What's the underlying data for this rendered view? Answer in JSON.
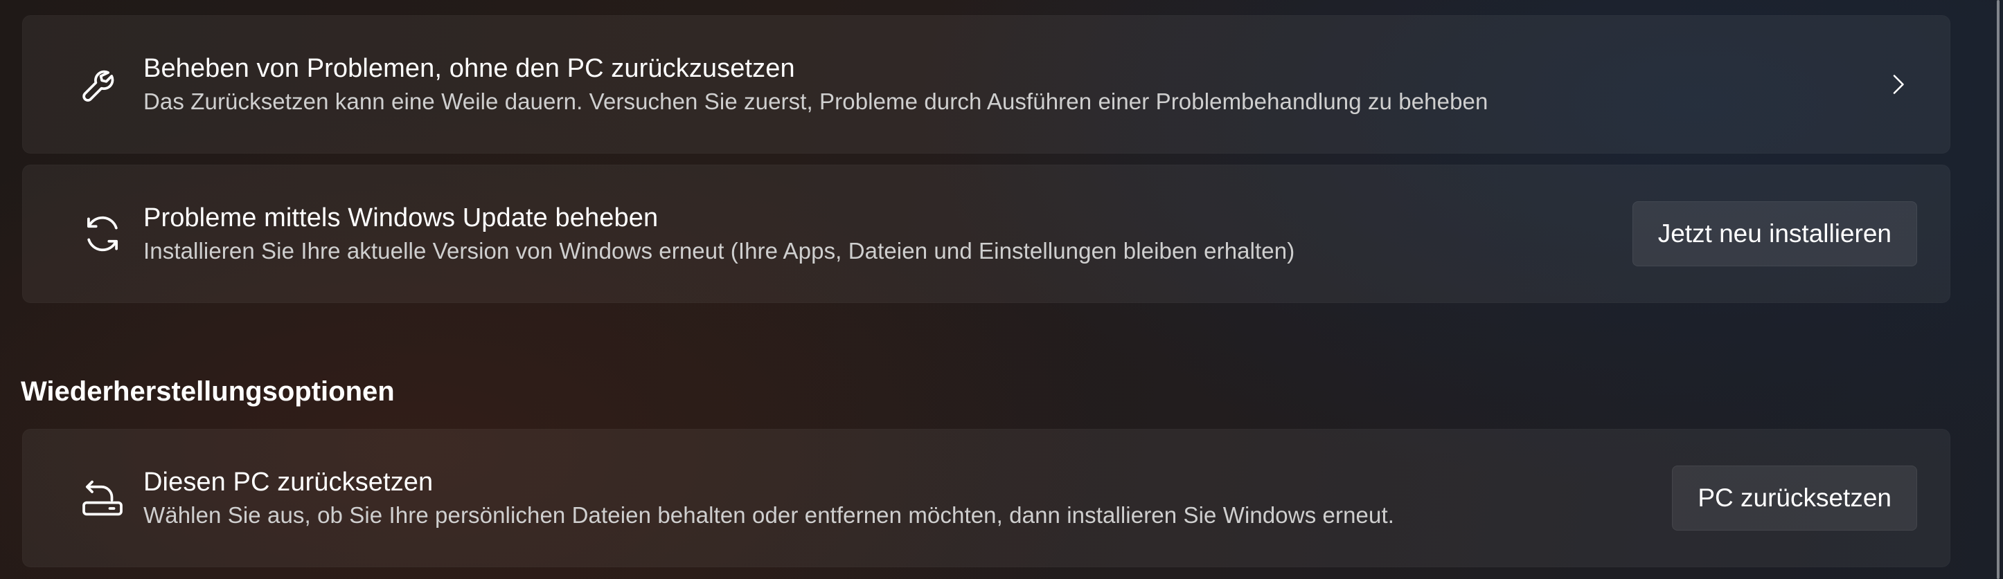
{
  "troubleshoot": {
    "title": "Beheben von Problemen, ohne den PC zurückzusetzen",
    "description": "Das Zurücksetzen kann eine Weile dauern. Versuchen Sie zuerst, Probleme durch Ausführen einer Problembehandlung zu beheben",
    "icon": "wrench-icon",
    "trailing_icon": "chevron-right-icon"
  },
  "winupdate": {
    "title": "Probleme mittels Windows Update beheben",
    "description": "Installieren Sie Ihre aktuelle Version von Windows erneut (Ihre Apps, Dateien und Einstellungen bleiben erhalten)",
    "icon": "sync-icon",
    "button_label": "Jetzt neu installieren"
  },
  "recovery_section": {
    "heading": "Wiederherstellungsoptionen"
  },
  "reset": {
    "title": "Diesen PC zurücksetzen",
    "description": "Wählen Sie aus, ob Sie Ihre persönlichen Dateien behalten oder entfernen möchten, dann installieren Sie Windows erneut.",
    "icon": "reset-pc-icon",
    "button_label": "PC zurücksetzen"
  },
  "colors": {
    "text_primary": "#ffffff",
    "text_secondary": "#cfcfcf",
    "card_background": "#2b2624",
    "button_background": "#36302e"
  }
}
